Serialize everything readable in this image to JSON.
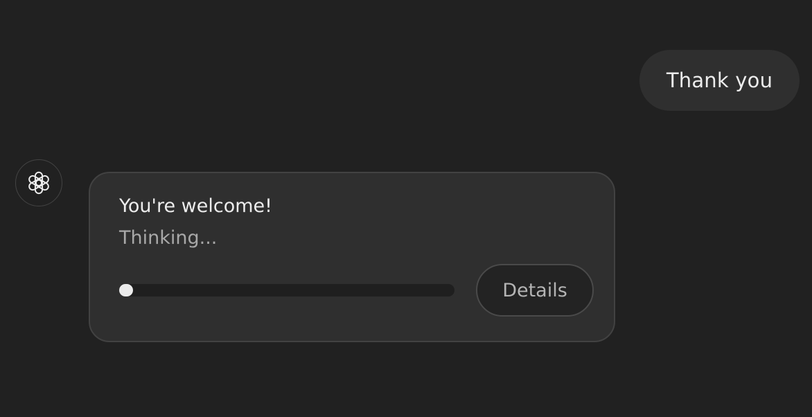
{
  "user_message": {
    "text": "Thank you"
  },
  "assistant": {
    "avatar_icon": "openai-logo-icon",
    "card": {
      "title": "You're welcome!",
      "status": "Thinking...",
      "progress_fraction": 0.04,
      "details_label": "Details"
    }
  },
  "colors": {
    "background": "#212121",
    "bubble": "#2f2f2f",
    "text_primary": "#ececec",
    "text_secondary": "#a8a8a8"
  }
}
